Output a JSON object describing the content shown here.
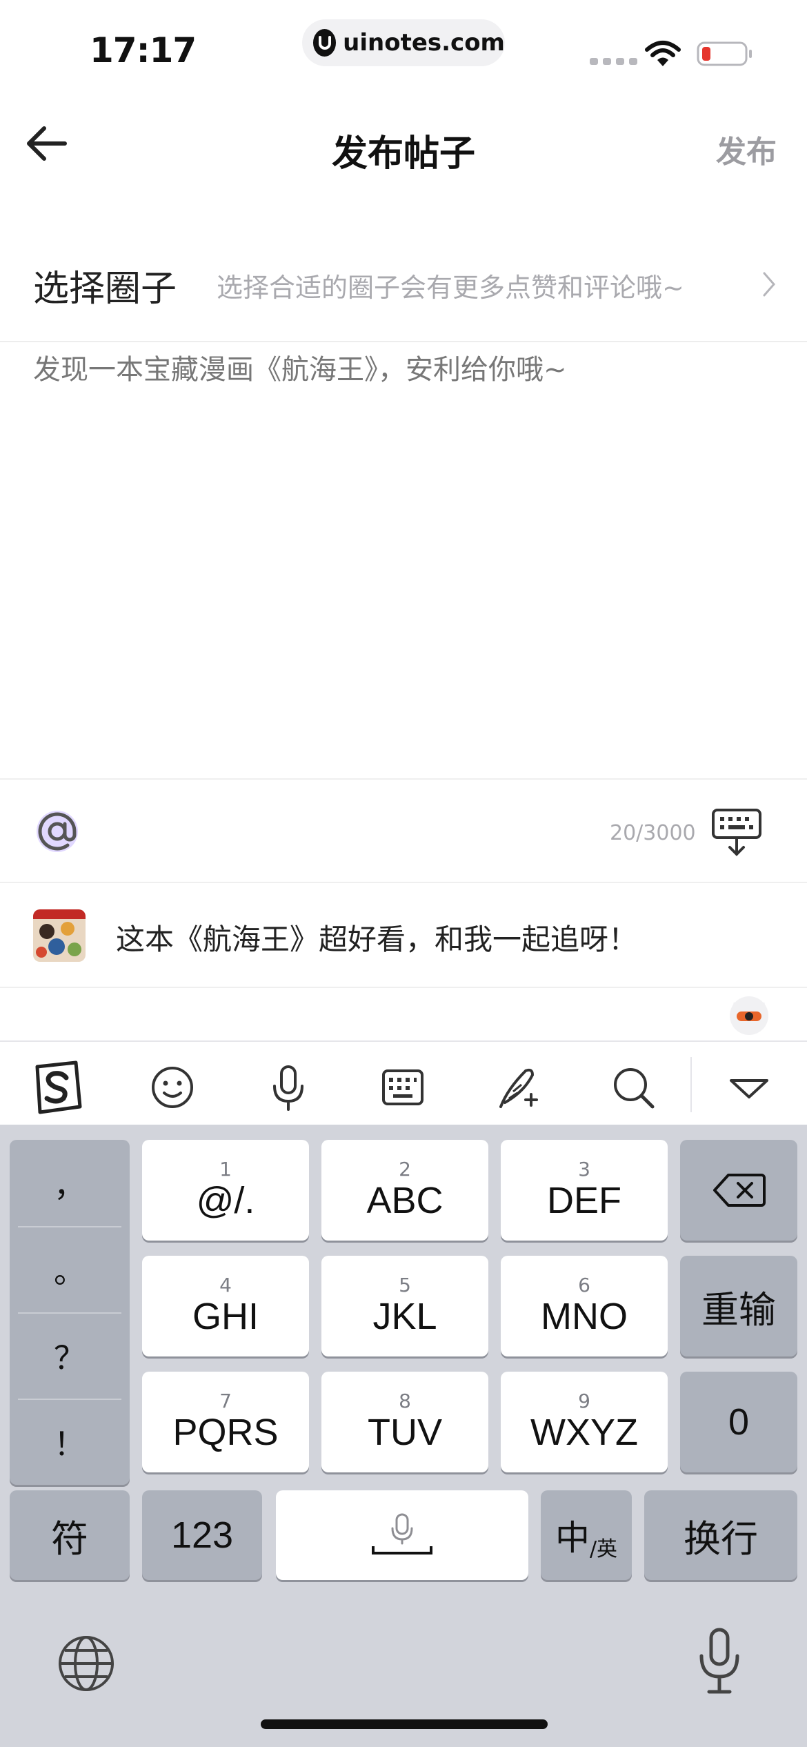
{
  "status_bar": {
    "time": "17:17",
    "url": "uinotes.com",
    "icons": [
      "signal-icon",
      "wifi-icon",
      "battery-low-icon"
    ],
    "battery_color": "#e5352d"
  },
  "nav": {
    "title": "发布帖子",
    "publish_label": "发布",
    "back_icon": "arrow-left-icon"
  },
  "circle": {
    "label": "选择圈子",
    "hint": "选择合适的圈子会有更多点赞和评论哦~",
    "icon": "chevron-right-icon"
  },
  "post": {
    "placeholder": "发现一本宝藏漫画《航海王》，安利给你哦~"
  },
  "toolbar": {
    "at_icon": "at-icon",
    "char_count": "20/3000",
    "hide_keyboard_icon": "keyboard-hide-icon",
    "accent_color": "#c9b8ff"
  },
  "suggestion": {
    "text": "这本《航海王》超好看，和我一起追呀！",
    "thumb_icon": "manga-cover-thumbnail"
  },
  "ime_bar": {
    "buttons": [
      "sogou-logo-icon",
      "emoji-icon",
      "microphone-icon",
      "keyboard-icon",
      "quill-pen-icon",
      "search-icon",
      "collapse-triangle-icon"
    ]
  },
  "keyboard": {
    "punctuation": [
      "，",
      "。",
      "？",
      "！"
    ],
    "keys": [
      {
        "num": "1",
        "letters": "@/."
      },
      {
        "num": "2",
        "letters": "ABC"
      },
      {
        "num": "3",
        "letters": "DEF"
      },
      {
        "num": "4",
        "letters": "GHI"
      },
      {
        "num": "5",
        "letters": "JKL"
      },
      {
        "num": "6",
        "letters": "MNO"
      },
      {
        "num": "7",
        "letters": "PQRS"
      },
      {
        "num": "8",
        "letters": "TUV"
      },
      {
        "num": "9",
        "letters": "WXYZ"
      }
    ],
    "delete_icon": "backspace-icon",
    "retype_label": "重输",
    "zero_label": "0",
    "symbol_label": "符",
    "numbers_label": "123",
    "lang_main": "中",
    "lang_sub": "/英",
    "enter_label": "换行",
    "globe_icon": "globe-icon",
    "dictation_icon": "microphone-icon"
  }
}
